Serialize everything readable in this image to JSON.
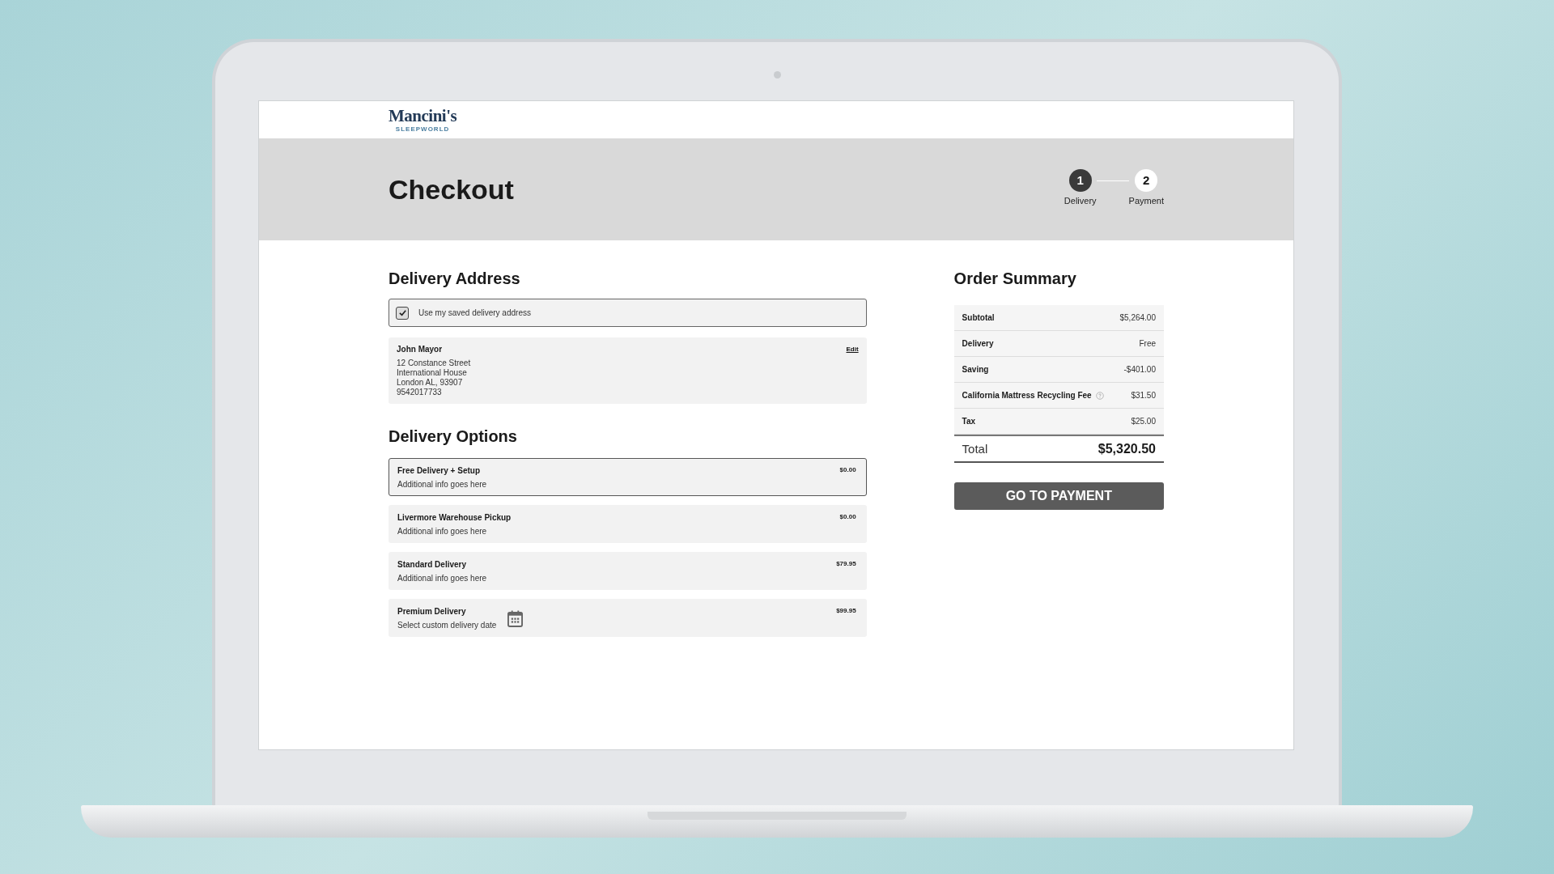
{
  "brand": {
    "name": "Mancini's",
    "tagline": "SLEEPWORLD"
  },
  "page_title": "Checkout",
  "steps": [
    {
      "number": "1",
      "label": "Delivery",
      "selected": true
    },
    {
      "number": "2",
      "label": "Payment",
      "selected": false
    }
  ],
  "delivery_address": {
    "heading": "Delivery Address",
    "saved_checkbox": {
      "label": "Use my saved delivery address",
      "checked": true
    },
    "address": {
      "name": "John Mayor",
      "edit": "Edit",
      "lines": [
        "12 Constance Street",
        "International House",
        "London AL, 93907",
        "9542017733"
      ]
    }
  },
  "delivery_options": {
    "heading": "Delivery Options",
    "options": [
      {
        "title": "Free Delivery + Setup",
        "info": "Additional info goes here",
        "price": "$0.00",
        "selected": true,
        "kind": "plain"
      },
      {
        "title": "Livermore Warehouse Pickup",
        "info": "Additional info goes here",
        "price": "$0.00",
        "selected": false,
        "kind": "plain"
      },
      {
        "title": "Standard Delivery",
        "info": "Additional info goes here",
        "price": "$79.95",
        "selected": false,
        "kind": "plain"
      },
      {
        "title": "Premium Delivery",
        "info": "Select custom delivery date",
        "price": "$99.95",
        "selected": false,
        "kind": "calendar"
      }
    ]
  },
  "order_summary": {
    "heading": "Order Summary",
    "rows": [
      {
        "label": "Subtotal",
        "value": "$5,264.00",
        "kind": "plain"
      },
      {
        "label": "Delivery",
        "value": "Free",
        "kind": "plain"
      },
      {
        "label": "Saving",
        "value": "-$401.00",
        "kind": "plain"
      },
      {
        "label": "California Mattress Recycling Fee",
        "value": "$31.50",
        "kind": "help"
      },
      {
        "label": "Tax",
        "value": "$25.00",
        "kind": "plain"
      }
    ],
    "total_label": "Total",
    "total_value": "$5,320.50",
    "button": "GO TO PAYMENT"
  }
}
